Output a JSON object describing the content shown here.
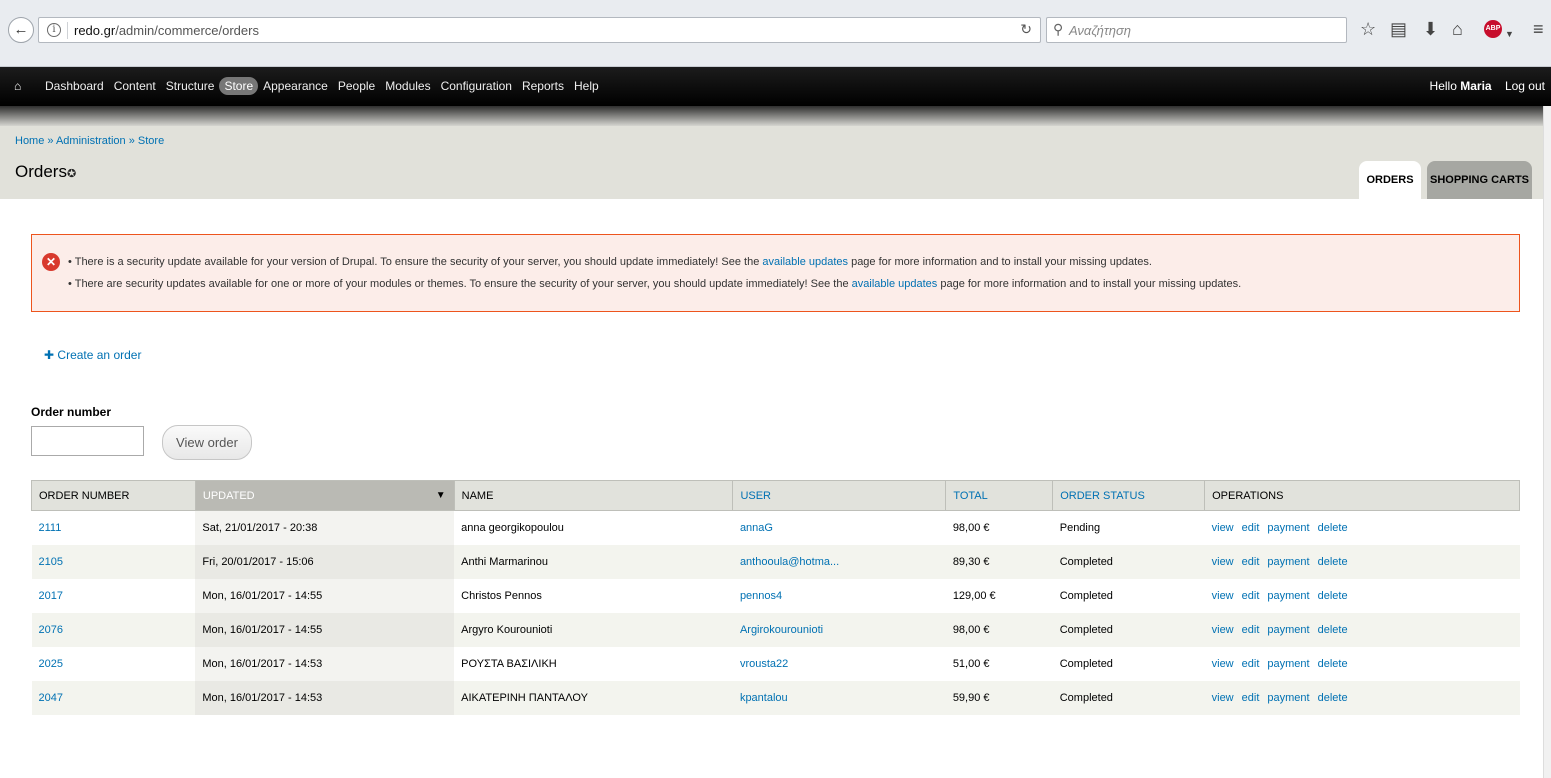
{
  "browser": {
    "url_domain": "redo.gr",
    "url_path": "/admin/commerce/orders",
    "search_placeholder": "Αναζήτηση"
  },
  "toolbar": {
    "items": [
      "Dashboard",
      "Content",
      "Structure",
      "Store",
      "Appearance",
      "People",
      "Modules",
      "Configuration",
      "Reports",
      "Help"
    ],
    "active": "Store",
    "hello_prefix": "Hello",
    "user_name": "Maria",
    "logout": "Log out"
  },
  "header": {
    "breadcrumb": "Home » Administration » Store",
    "title": "Orders",
    "tabs": [
      "ORDERS",
      "SHOPPING CARTS"
    ]
  },
  "messages": [
    {
      "before": "There is a security update available for your version of Drupal. To ensure the security of your server, you should update immediately! See the ",
      "link": "available updates",
      "after": " page for more information and to install your missing updates."
    },
    {
      "before": "There are security updates available for one or more of your modules or themes. To ensure the security of your server, you should update immediately! See the ",
      "link": "available updates",
      "after": " page for more information and to install your missing updates."
    }
  ],
  "create_link": "Create an order",
  "order_form": {
    "label": "Order number",
    "value": "",
    "button": "View order"
  },
  "table": {
    "columns": [
      "ORDER NUMBER",
      "UPDATED",
      "NAME",
      "USER",
      "TOTAL",
      "ORDER STATUS",
      "OPERATIONS"
    ],
    "operations": [
      "view",
      "edit",
      "payment",
      "delete"
    ],
    "rows": [
      {
        "number": "2111",
        "updated": "Sat, 21/01/2017 - 20:38",
        "name": "anna georgikopoulou",
        "user": "annaG",
        "total": "98,00 €",
        "status": "Pending"
      },
      {
        "number": "2105",
        "updated": "Fri, 20/01/2017 - 15:06",
        "name": "Anthi Marmarinou",
        "user": "anthooula@hotma...",
        "total": "89,30 €",
        "status": "Completed"
      },
      {
        "number": "2017",
        "updated": "Mon, 16/01/2017 - 14:55",
        "name": "Christos Pennos",
        "user": "pennos4",
        "total": "129,00 €",
        "status": "Completed"
      },
      {
        "number": "2076",
        "updated": "Mon, 16/01/2017 - 14:55",
        "name": "Argyro Kourounioti",
        "user": "Argirokourounioti",
        "total": "98,00 €",
        "status": "Completed"
      },
      {
        "number": "2025",
        "updated": "Mon, 16/01/2017 - 14:53",
        "name": "ΡΟΥΣΤΑ ΒΑΣΙΛΙΚΗ",
        "user": "vrousta22",
        "total": "51,00 €",
        "status": "Completed"
      },
      {
        "number": "2047",
        "updated": "Mon, 16/01/2017 - 14:53",
        "name": "ΑΙΚΑΤΕΡΙΝΗ ΠΑΝΤΑΛΟΥ",
        "user": "kpantalou",
        "total": "59,90 €",
        "status": "Completed"
      }
    ]
  }
}
